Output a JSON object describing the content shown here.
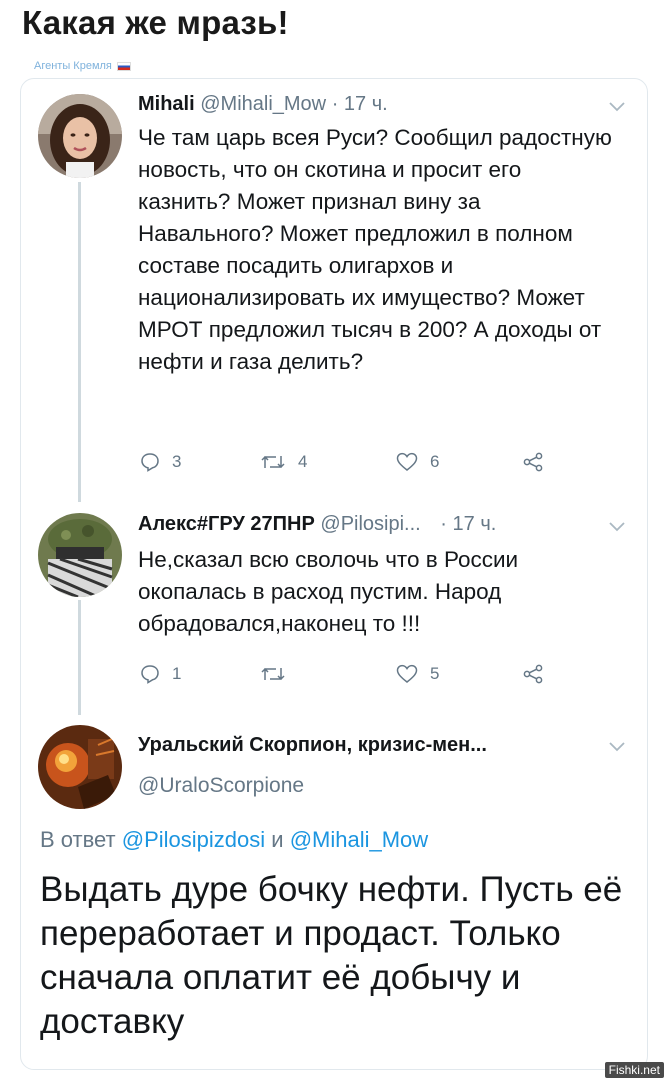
{
  "page": {
    "title": "Какая же мразь!",
    "source": "Агенты Кремля",
    "watermark": "Fishki.net"
  },
  "colors": {
    "link_blue": "#1b95e0",
    "muted_gray": "#657786",
    "text": "#14171a",
    "thread_line": "#cfd9de"
  },
  "tweets": [
    {
      "name": "Mihali",
      "handle": "@Mihali_Mow",
      "time": "· 17 ч.",
      "text": "Че там царь всея Руси? Сообщил радостную новость, что он скотина и просит его казнить? Может признал вину за Навального? Может предложил в полном составе посадить олигархов и национализировать их имущество? Может МРОТ предложил тысяч в 200? А доходы от нефти и газа делить?",
      "replies": "3",
      "retweets": "4",
      "likes": "6"
    },
    {
      "name": "Алекс#ГРУ 27ПНР",
      "handle": "@Pilosipi...",
      "time": "· 17 ч.",
      "text": "Не,сказал всю сволочь что в России окопалась в расход пустим. Народ обрадовался,наконец то !!!",
      "replies": "1",
      "retweets": "",
      "likes": "5"
    },
    {
      "name": "Уральский Скорпион, кризис-мен...",
      "handle": "@UraloScorpione",
      "reply_prefix": "В ответ",
      "mention1": "@Pilosipizdosi",
      "conj": "и",
      "mention2": "@Mihali_Mow",
      "text": "Выдать дуре бочку нефти. Пусть её переработает и продаст. Только сначала оплатит её добычу и доставку"
    }
  ],
  "icons": [
    "reply-icon",
    "retweet-icon",
    "like-icon",
    "share-icon",
    "chevron-down-icon"
  ]
}
